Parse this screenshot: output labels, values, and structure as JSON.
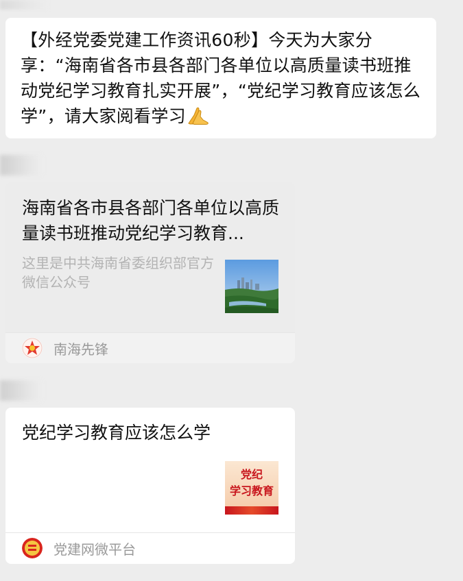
{
  "messages": {
    "text_message": "【外经党委党建工作资讯60秒】今天为大家分享：“海南省各市县各部门各单位以高质量读书班推动党纪学习教育扎实开展”，“党纪学习教育应该怎么学”，请大家阅看学习",
    "text_message_emoji": "praying-hands"
  },
  "cards": [
    {
      "title": "海南省各市县各部门各单位以高质量读书班推动党纪学习教育...",
      "description": "这里是中共海南省委组织部官方微信公众号",
      "source": "南海先锋",
      "thumb": "city-landscape-image",
      "source_icon": "nanhai-xianfeng-logo"
    },
    {
      "title": "党纪学习教育应该怎么学",
      "description": "",
      "thumb_line1": "党纪",
      "thumb_line2": "学习教育",
      "source": "党建网微平台",
      "source_icon": "dangjian-logo"
    }
  ],
  "colors": {
    "background": "#ededed",
    "bubble": "#ffffff",
    "muted_text": "#b3b3b3",
    "source_text": "#9a9a9a",
    "thumb_red": "#c8161d"
  }
}
